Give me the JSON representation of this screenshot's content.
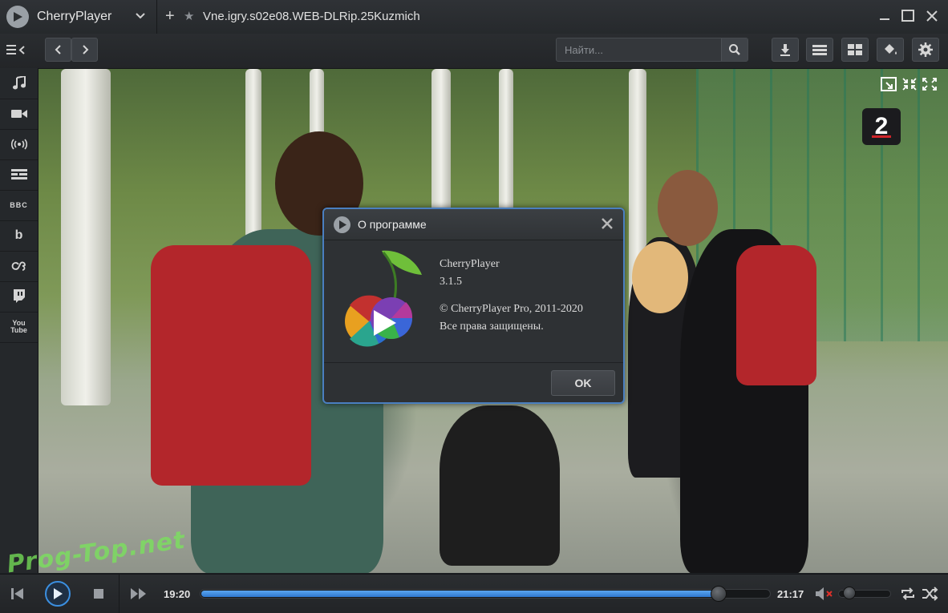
{
  "app": {
    "name": "CherryPlayer",
    "file_title": "Vne.igry.s02e08.WEB-DLRip.25Kuzmich"
  },
  "toolbar": {
    "search_placeholder": "Найти..."
  },
  "sidebar": {
    "items": [
      {
        "name": "music",
        "icon": "music-note-icon"
      },
      {
        "name": "video",
        "icon": "camera-icon"
      },
      {
        "name": "radio",
        "icon": "broadcast-icon"
      },
      {
        "name": "tv",
        "icon": "tv-guide-icon"
      },
      {
        "name": "bbc",
        "label": "BBC"
      },
      {
        "name": "bandcamp",
        "label": "b"
      },
      {
        "name": "lastfm",
        "icon": "lastfm-icon"
      },
      {
        "name": "twitch",
        "icon": "twitch-icon"
      },
      {
        "name": "youtube",
        "label": "You Tube"
      }
    ]
  },
  "video": {
    "channel_logo_text": "2"
  },
  "about_dialog": {
    "title": "О программе",
    "product": "CherryPlayer",
    "version": "3.1.5",
    "copyright": "© CherryPlayer Pro, 2011-2020",
    "rights": "Все права защищены.",
    "ok_label": "OK"
  },
  "playback": {
    "current_time": "19:20",
    "total_time": "21:17",
    "progress_fraction": 0.91,
    "volume_fraction": 0.1,
    "muted": true
  },
  "watermark": "Prog-Top.net",
  "colors": {
    "accent": "#3b8fe0",
    "dialog_border": "#4a7fc0",
    "progress": "#4a94e6"
  }
}
